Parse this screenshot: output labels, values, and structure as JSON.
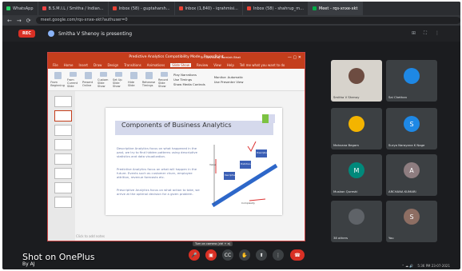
{
  "browser": {
    "tabs": [
      {
        "label": "WhatsApp",
        "color": "#25d366"
      },
      {
        "label": "B.S.M.I.L / Smitha / Indian...",
        "color": "#e44"
      },
      {
        "label": "Inbox (58) - guptaharsh...",
        "color": "#ea4335"
      },
      {
        "label": "Inbox (1,840) - iqrahmisi...",
        "color": "#ea4335"
      },
      {
        "label": "Inbox (58) - shahrup_m...",
        "color": "#ea4335"
      },
      {
        "label": "Meet - rqs-xnxe-xkt",
        "color": "#00ac47"
      }
    ],
    "url": "meet.google.com/rqs-xnxe-xkt?authuser=0"
  },
  "meet": {
    "rec_label": "REC",
    "presenting_text": "Smitha V Shenoy is presenting",
    "tooltip": "Turn on camera (ctrl + e)",
    "participants": [
      {
        "name": "Smitha V Shenoy",
        "initial": "",
        "color": "#6d4c41"
      },
      {
        "name": "Sai Chethan",
        "initial": "",
        "color": "#1e88e5"
      },
      {
        "name": "Mahvana Begam",
        "initial": "",
        "color": "#f4b400"
      },
      {
        "name": "Surya Narayana K Nage",
        "initial": "S",
        "color": "#1e88e5"
      },
      {
        "name": "Muskan Qureshi",
        "initial": "M",
        "color": "#00897b"
      },
      {
        "name": "ARCHANA KUMARI",
        "initial": "A",
        "color": "#8e7d80"
      },
      {
        "name": "38 others",
        "initial": "",
        "color": "#5f6368"
      },
      {
        "name": "You",
        "initial": "S",
        "color": "#8d6e63"
      }
    ]
  },
  "powerpoint": {
    "window_title": "Predictive Analytics Compatibility Mode - PowerPoint",
    "user": "Sri Govindraj Ramiah Bhat",
    "menu": [
      "File",
      "Home",
      "Insert",
      "Draw",
      "Design",
      "Transitions",
      "Animations",
      "Slide Show",
      "Review",
      "View",
      "Help"
    ],
    "selected_menu": "Slide Show",
    "search_hint": "Tell me what you want to do",
    "ribbon": {
      "buttons": [
        "From Beginning",
        "From Current Slide",
        "Present Online",
        "Custom Slide Show",
        "Set Up Slide Show",
        "Hide Slide",
        "Rehearse Timings",
        "Record Slide Show"
      ],
      "checks": [
        "Play Narrations",
        "Use Timings",
        "Show Media Controls"
      ],
      "monitor_label": "Monitor: Automatic",
      "presenter_view": "Use Presenter View"
    },
    "slide": {
      "title": "Components of Business Analytics",
      "bullets": [
        "Descriptive Analytics focus on what happened in the past, we try to find hidden patterns using descriptive statistics and data visualization.",
        "Predictive Analytics focus on what will happen in the future. Events such as customer churn, employee attrition, revenue forecasts etc.",
        "Prescriptive Analytics focus on what action to take, we arrive at the optimal decision for a given problem."
      ],
      "graph_labels": [
        "Descriptive Analytics",
        "Predictive Analytics",
        "Prescriptive Analytics"
      ],
      "arrow_labels": [
        "Value",
        "Complexity"
      ],
      "notes_hint": "Click to add notes"
    }
  },
  "overlay": {
    "brand": "Shot on OnePlus",
    "by": "By AJ",
    "clock": "5:36 PM 23-07-2021"
  }
}
